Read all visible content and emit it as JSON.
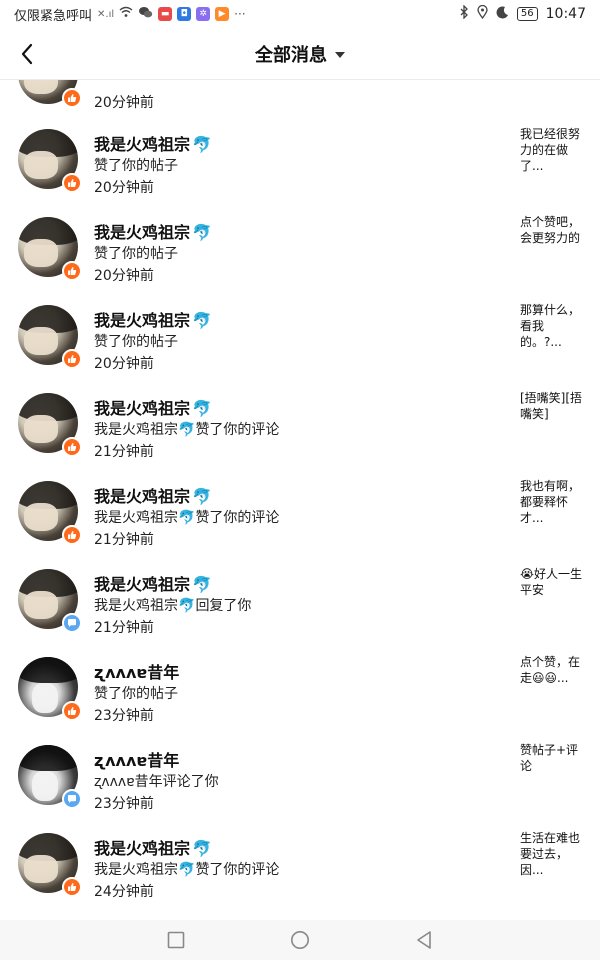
{
  "status_bar": {
    "carrier": "仅限紧急呼叫",
    "signal": "✕.ıl",
    "battery": "56",
    "time": "10:47"
  },
  "header": {
    "back_icon": "chevron-left-icon",
    "title": "全部消息"
  },
  "dolphin_emoji": "🐬",
  "messages": [
    {
      "avatar": "light",
      "name": "",
      "action": "",
      "time": "20分钟前",
      "preview": "",
      "badge": "like"
    },
    {
      "avatar": "light",
      "name": "我是火鸡祖宗",
      "action": "赞了你的帖子",
      "time": "20分钟前",
      "preview": "我已经很努力的在做了...",
      "badge": "like"
    },
    {
      "avatar": "light",
      "name": "我是火鸡祖宗",
      "action": "赞了你的帖子",
      "time": "20分钟前",
      "preview": "点个赞吧，会更努力的",
      "badge": "like"
    },
    {
      "avatar": "light",
      "name": "我是火鸡祖宗",
      "action": "赞了你的帖子",
      "time": "20分钟前",
      "preview": "那算什么，看我的。?...",
      "badge": "like"
    },
    {
      "avatar": "light",
      "name": "我是火鸡祖宗",
      "action_prefix": "我是火鸡祖宗",
      "action": "赞了你的评论",
      "time": "21分钟前",
      "preview": "[捂嘴笑][捂嘴笑]",
      "badge": "like"
    },
    {
      "avatar": "light",
      "name": "我是火鸡祖宗",
      "action_prefix": "我是火鸡祖宗",
      "action": "赞了你的评论",
      "time": "21分钟前",
      "preview": "我也有啊，都要释怀才...",
      "badge": "like"
    },
    {
      "avatar": "light",
      "name": "我是火鸡祖宗",
      "action_prefix": "我是火鸡祖宗",
      "action": "回复了你",
      "time": "21分钟前",
      "preview": "😭好人一生平安",
      "badge": "comment"
    },
    {
      "avatar": "dark",
      "name": "ʐʌʌʌɐ昔年",
      "action": "赞了你的帖子",
      "time": "23分钟前",
      "preview": "点个赞，在走😃😃...",
      "badge": "like"
    },
    {
      "avatar": "dark",
      "name": "ʐʌʌʌɐ昔年",
      "action_prefix": "ʐʌʌʌɐ昔年",
      "action": "评论了你",
      "time": "23分钟前",
      "preview": "赞帖子+评论",
      "badge": "comment"
    },
    {
      "avatar": "light",
      "name": "我是火鸡祖宗",
      "action_prefix": "我是火鸡祖宗",
      "action": "赞了你的评论",
      "time": "24分钟前",
      "preview": "生活在难也要过去，因...",
      "badge": "like"
    }
  ],
  "nav": {
    "recent_icon": "square-icon",
    "home_icon": "circle-icon",
    "back_icon": "triangle-back-icon"
  },
  "colors": {
    "like_badge": "#ff6a1a",
    "comment_badge": "#5aa7f2",
    "dolphin": "#2f8be0"
  }
}
